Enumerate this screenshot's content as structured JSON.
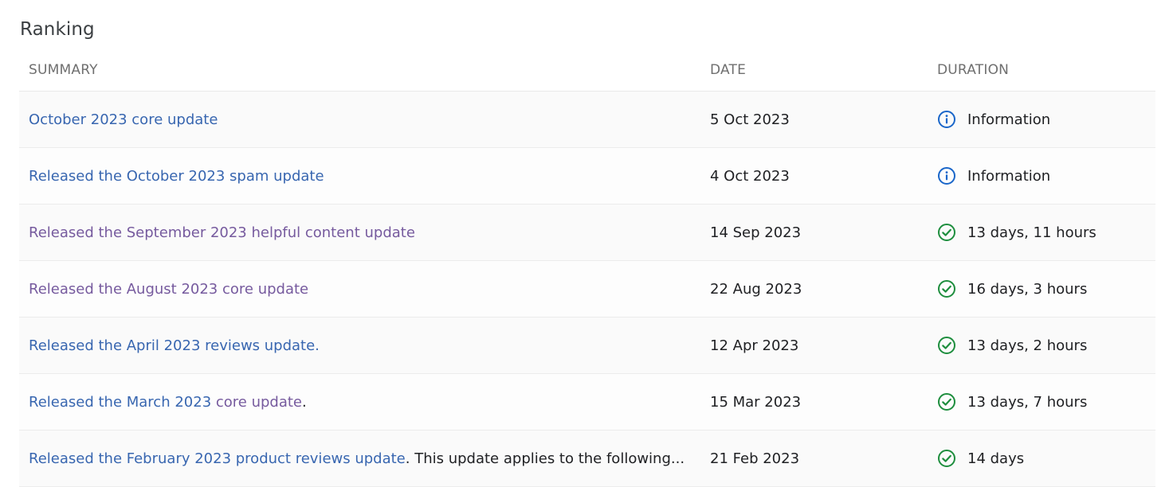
{
  "section": {
    "title": "Ranking"
  },
  "table": {
    "headers": {
      "summary": "SUMMARY",
      "date": "DATE",
      "duration": "DURATION"
    },
    "colors": {
      "link": "#3866b0",
      "link_visited": "#765a9e",
      "info_icon": "#1a66c9",
      "success_icon": "#1e8e3e"
    },
    "rows": [
      {
        "summary_parts": [
          {
            "text": "October 2023 core update",
            "type": "link"
          }
        ],
        "date": "5 Oct 2023",
        "status_icon": "info-icon",
        "duration": "Information"
      },
      {
        "summary_parts": [
          {
            "text": "Released the October 2023 spam update",
            "type": "link"
          }
        ],
        "date": "4 Oct 2023",
        "status_icon": "info-icon",
        "duration": "Information"
      },
      {
        "summary_parts": [
          {
            "text": "Released the September 2023 helpful content update",
            "type": "link-visited"
          }
        ],
        "date": "14 Sep 2023",
        "status_icon": "check-circle-icon",
        "duration": "13 days, 11 hours"
      },
      {
        "summary_parts": [
          {
            "text": "Released the August 2023 core update",
            "type": "link-visited"
          }
        ],
        "date": "22 Aug 2023",
        "status_icon": "check-circle-icon",
        "duration": "16 days, 3 hours"
      },
      {
        "summary_parts": [
          {
            "text": "Released the April 2023 reviews update.",
            "type": "link"
          }
        ],
        "date": "12 Apr 2023",
        "status_icon": "check-circle-icon",
        "duration": "13 days, 2 hours"
      },
      {
        "summary_parts": [
          {
            "text": "Released the March 2023 ",
            "type": "link"
          },
          {
            "text": "core update",
            "type": "link-visited"
          },
          {
            "text": ".",
            "type": "plain"
          }
        ],
        "date": "15 Mar 2023",
        "status_icon": "check-circle-icon",
        "duration": "13 days, 7 hours"
      },
      {
        "summary_parts": [
          {
            "text": "Released the February 2023 product reviews update",
            "type": "link"
          },
          {
            "text": ". This update applies to the following...",
            "type": "plain"
          }
        ],
        "date": "21 Feb 2023",
        "status_icon": "check-circle-icon",
        "duration": "14 days"
      }
    ]
  }
}
